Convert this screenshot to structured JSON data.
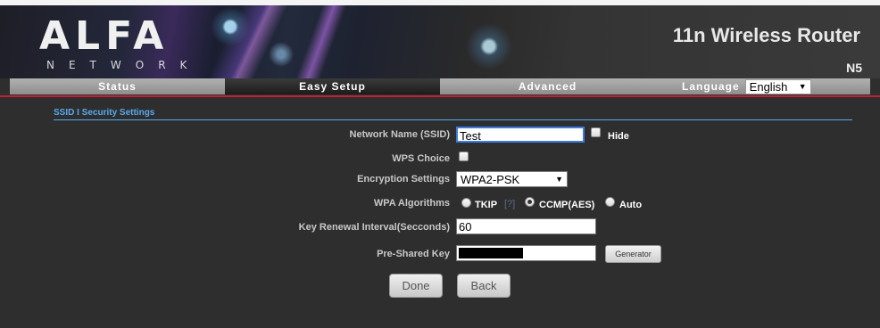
{
  "header": {
    "logo_word": "ALFA",
    "logo_sub": "NETWORK",
    "product_title": "11n Wireless Router",
    "model": "N5"
  },
  "nav": {
    "tabs": [
      {
        "label": "Status",
        "active": false
      },
      {
        "label": "Easy Setup",
        "active": true
      },
      {
        "label": "Advanced",
        "active": false
      }
    ],
    "language_label": "Language",
    "language_value": "English"
  },
  "section": {
    "title": "SSID I Security Settings"
  },
  "form": {
    "ssid_label": "Network Name (SSID)",
    "ssid_value": "Test",
    "hide_label": "Hide",
    "hide_checked": false,
    "wps_label": "WPS Choice",
    "wps_checked": false,
    "encryption_label": "Encryption Settings",
    "encryption_value": "WPA2-PSK",
    "wpa_label": "WPA Algorithms",
    "wpa_options": [
      {
        "label": "TKIP",
        "checked": false
      },
      {
        "label": "CCMP(AES)",
        "checked": true
      },
      {
        "label": "Auto",
        "checked": false
      }
    ],
    "tkip_help": "[?]",
    "interval_label": "Key Renewal Interval(Secconds)",
    "interval_value": "60",
    "psk_label": "Pre-Shared Key",
    "generator_label": "Generator"
  },
  "actions": {
    "done_label": "Done",
    "back_label": "Back"
  },
  "colors": {
    "accent": "#5aa8ec",
    "divider": "#c3203a",
    "background": "#2e2e2e"
  }
}
